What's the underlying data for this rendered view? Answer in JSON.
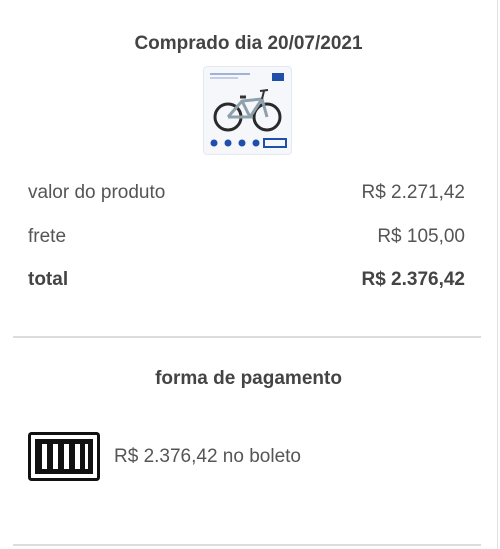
{
  "purchase": {
    "title": "Comprado dia 20/07/2021",
    "product_image_icon": "bicycle-product-image"
  },
  "summary": {
    "product_label": "valor do produto",
    "product_value": "R$ 2.271,42",
    "shipping_label": "frete",
    "shipping_value": "R$ 105,00",
    "total_label": "total",
    "total_value": "R$ 2.376,42"
  },
  "payment": {
    "title": "forma de pagamento",
    "method_icon": "barcode-icon",
    "method_text": "R$ 2.376,42 no boleto"
  },
  "colors": {
    "text": "#3f3f3f",
    "divider": "#dcdcdc",
    "thumb_background": "#f5f7fb",
    "brand_blue": "#1f4fa8"
  }
}
